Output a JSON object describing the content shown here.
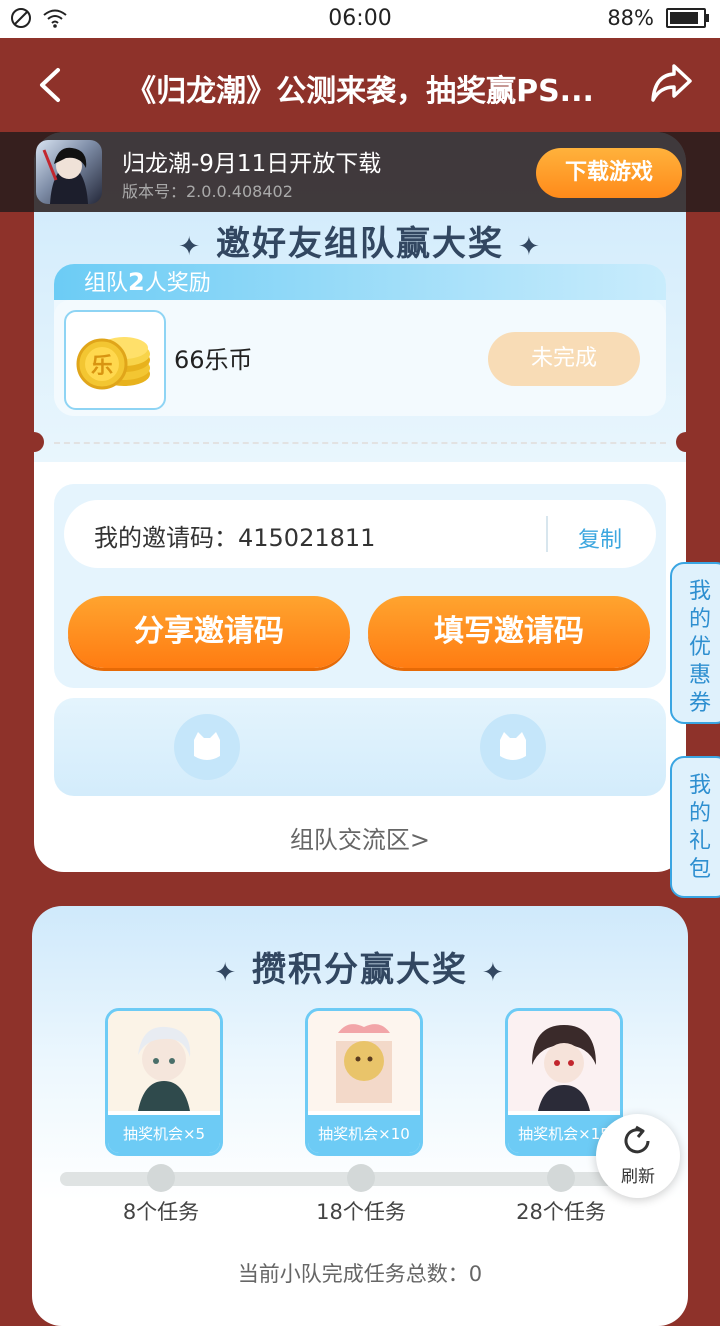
{
  "status_bar": {
    "time": "06:00",
    "battery": "88%",
    "battery_level": 0.88
  },
  "header": {
    "title": "《归龙潮》公测来袭，抽奖赢PS..."
  },
  "banner": {
    "game_name": "归龙潮-9月11日开放下载",
    "version": "版本号：2.0.0.408402",
    "download_label": "下载游戏"
  },
  "team_section": {
    "title": "邀好友组队赢大奖",
    "tier_prefix": "组队",
    "tier_count": "2",
    "tier_suffix": "人奖励",
    "coin_char": "乐",
    "reward_name": "66乐币",
    "reward_status": "未完成",
    "invite_label": "我的邀请码：415021811",
    "copy_label": "复制",
    "share_button": "分享邀请码",
    "fill_button": "填写邀请码",
    "team_link": "组队交流区>"
  },
  "side_tabs": {
    "coupons": "我的优惠券",
    "gifts": "我的礼包"
  },
  "score_section": {
    "title": "攒积分赢大奖",
    "prizes": [
      {
        "caption": "抽奖机会×5",
        "tasks": "8个任务"
      },
      {
        "caption": "抽奖机会×10",
        "tasks": "18个任务"
      },
      {
        "caption": "抽奖机会×15",
        "tasks": "28个任务"
      }
    ],
    "team_total": "当前小队完成任务总数：0"
  },
  "refresh_label": "刷新",
  "colors": {
    "brand_red": "#8e322a",
    "accent_orange": "#ff8a1a",
    "accent_blue": "#3aa5e2"
  }
}
